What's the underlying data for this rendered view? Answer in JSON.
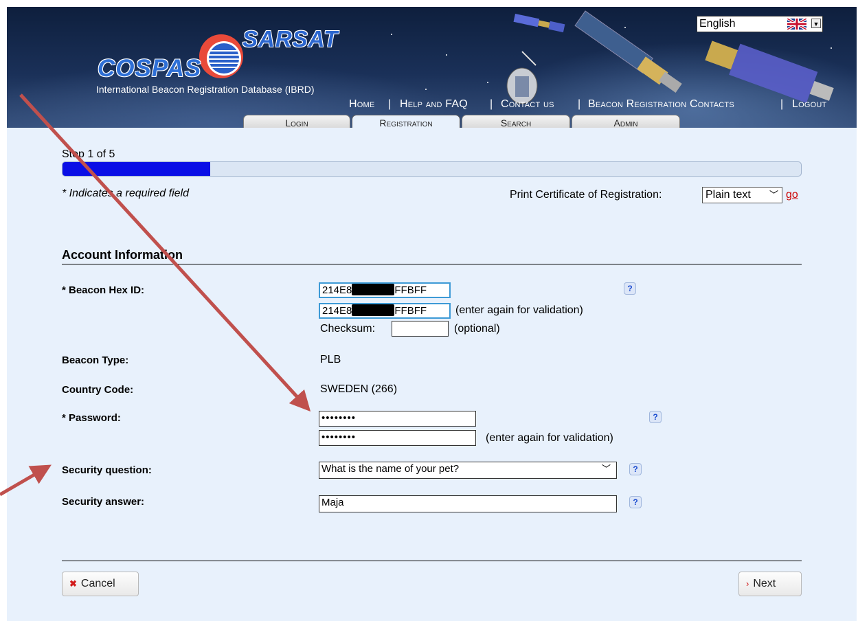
{
  "header": {
    "logo_sarsat": "SARSAT",
    "logo_cospas": "COSPAS",
    "site_title": "International Beacon Registration Database (IBRD)",
    "language": "English",
    "nav": [
      {
        "label": "Home"
      },
      {
        "label": "Help and FAQ"
      },
      {
        "label": "Contact us"
      },
      {
        "label": "Beacon Registration Contacts"
      },
      {
        "label": "Logout"
      }
    ],
    "tabs": [
      {
        "label": "Login",
        "active": false
      },
      {
        "label": "Registration",
        "active": true
      },
      {
        "label": "Search",
        "active": false
      },
      {
        "label": "Admin",
        "active": false
      }
    ]
  },
  "progress": {
    "step_text": "Step 1 of 5",
    "fraction": 0.2
  },
  "required_note": "* Indicates a required field",
  "print_certificate": {
    "label": "Print Certificate of Registration:",
    "selected": "Plain text",
    "go": "go"
  },
  "section_title": "Account Information",
  "form": {
    "beacon_hex_label": "* Beacon Hex ID:",
    "beacon_hex_prefix": "214E8",
    "beacon_hex_suffix": "FFBFF",
    "validation_note": "(enter again for validation)",
    "checksum_label": "Checksum:",
    "checksum_value": "",
    "optional_note": "(optional)",
    "beacon_type_label": "Beacon Type:",
    "beacon_type_value": "PLB",
    "country_code_label": "Country Code:",
    "country_code_value": "SWEDEN (266)",
    "password_label": "* Password:",
    "password_mask": "••••••••",
    "password_note": "(enter again for validation)",
    "security_question_label": "Security question:",
    "security_question_value": "What is the name of your pet?",
    "security_answer_label": "Security answer:",
    "security_answer_value": "Maja",
    "help_glyph": "?"
  },
  "buttons": {
    "cancel": "Cancel",
    "next": "Next"
  },
  "colors": {
    "progress_fill": "#0a0fe6",
    "annotation_arrow": "#c0504d",
    "link_red": "#cc0000",
    "page_bg": "#e8f1fc"
  }
}
